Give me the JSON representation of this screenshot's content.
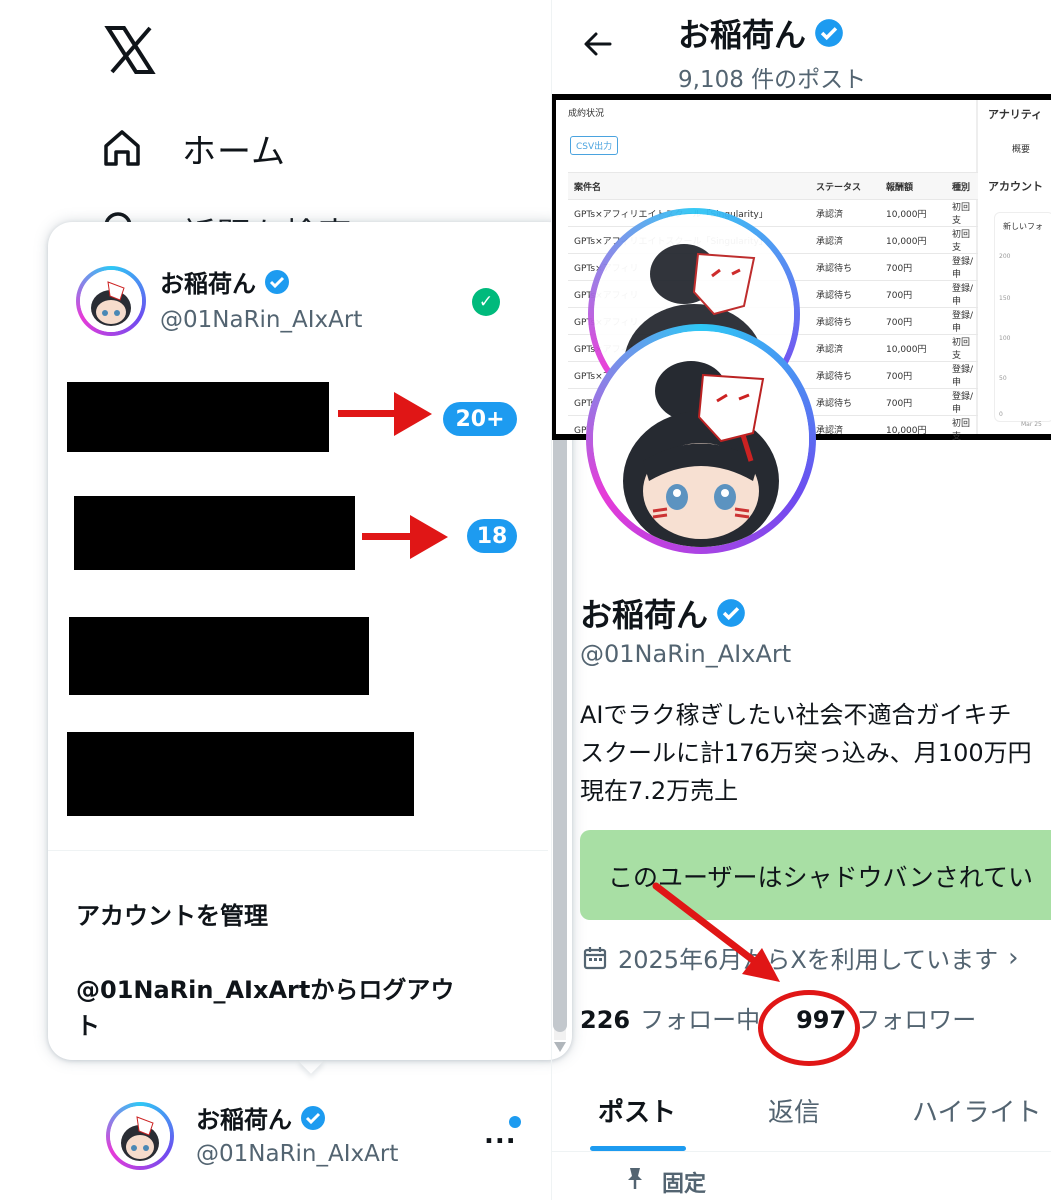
{
  "nav": {
    "logo": "x-logo",
    "home_label": "ホーム",
    "explore_label": "話題を検索"
  },
  "popup": {
    "name": "お稲荷ん",
    "handle": "@01NaRin_AIxArt",
    "badges": [
      "20+",
      "18"
    ],
    "manage_label": "アカウントを管理",
    "logout_label": "@01NaRin_AIxArtからログアウト"
  },
  "switcher": {
    "name": "お稲荷ん",
    "handle": "@01NaRin_AIxArt",
    "more": "..."
  },
  "profile": {
    "title": "お稲荷ん",
    "posts_count": "9,108 件のポスト",
    "name": "お稲荷ん",
    "handle": "@01NaRin_AIxArt",
    "bio": "AIでラク稼ぎしたい社会不適合ガイキチ\nスクールに計176万突っ込み、月100万円\n現在7.2万売上",
    "shadowban_text": "このユーザーはシャドウバンされてい",
    "joined": "2025年6月からXを利用しています",
    "following_count": "226",
    "following_label": "フォロー中",
    "followers_count": "997",
    "followers_label": "フォロワー",
    "tabs": [
      "ポスト",
      "返信",
      "ハイライト"
    ],
    "pinned_label": "固定"
  },
  "banner": {
    "section_title": "成約状況",
    "csv_button": "CSV出力",
    "right_title": "アナリティ",
    "right_tab": "概要",
    "right_section": "アカウント",
    "right_chip": "新しいフォ",
    "chart_ticks": [
      "200",
      "150",
      "100",
      "50",
      "0"
    ],
    "chart_xlabel": "Mar 25",
    "columns": [
      "案件名",
      "ステータス",
      "報酬額",
      "種別"
    ],
    "rows": [
      [
        "GPTs×アフィリエイトスクール「Singularity」",
        "承認済",
        "10,000円",
        "初回支"
      ],
      [
        "GPTs×アフィリエイトスクール「Singularity」",
        "承認済",
        "10,000円",
        "初回支"
      ],
      [
        "GPTs×アフィリ",
        "承認待ち",
        "700円",
        "登録/申"
      ],
      [
        "GPTs×アフィリ",
        "承認待ち",
        "700円",
        "登録/申"
      ],
      [
        "GPTs×アフィリ",
        "承認待ち",
        "700円",
        "登録/申"
      ],
      [
        "GPTs×アフィリ",
        "承認済",
        "10,000円",
        "初回支"
      ],
      [
        "GPTs×アフィリ",
        "承認待ち",
        "700円",
        "登録/申"
      ],
      [
        "GPTs×アフィリ",
        "承認待ち",
        "700円",
        "登録/申"
      ],
      [
        "GPTs×アフィリ",
        "承認済",
        "10,000円",
        "初回支"
      ]
    ]
  },
  "colors": {
    "accent": "#1d9bf0",
    "annotation_red": "#e01616",
    "verified_green": "#00ba7c",
    "shadowban_bg": "#a8dfa4"
  }
}
